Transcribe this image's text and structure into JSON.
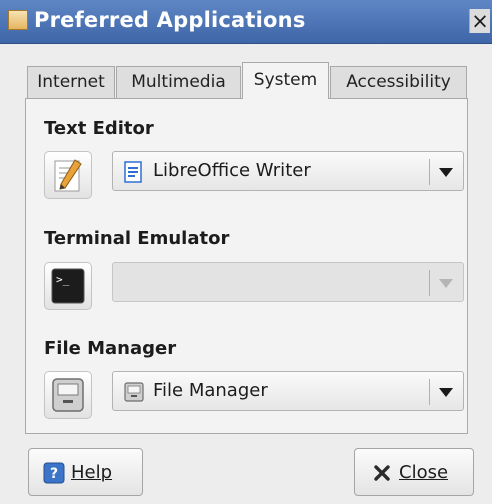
{
  "window": {
    "title": "Preferred Applications",
    "close_glyph": "×"
  },
  "tabs": [
    {
      "label": "Internet",
      "active": false
    },
    {
      "label": "Multimedia",
      "active": false
    },
    {
      "label": "System",
      "active": true
    },
    {
      "label": "Accessibility",
      "active": false
    }
  ],
  "sections": {
    "text_editor": {
      "label": "Text Editor",
      "icon": "text-editor-icon",
      "selected": "LibreOffice Writer"
    },
    "terminal": {
      "label": "Terminal Emulator",
      "icon": "terminal-icon",
      "selected": ""
    },
    "file_manager": {
      "label": "File Manager",
      "icon": "file-manager-icon",
      "selected": "File Manager"
    }
  },
  "buttons": {
    "help": {
      "label": "Help",
      "icon": "help-icon"
    },
    "close": {
      "label": "Close",
      "icon": "close-x-icon"
    }
  },
  "colors": {
    "titlebar": "#4a72b4",
    "accent": "#2f6fd1"
  }
}
